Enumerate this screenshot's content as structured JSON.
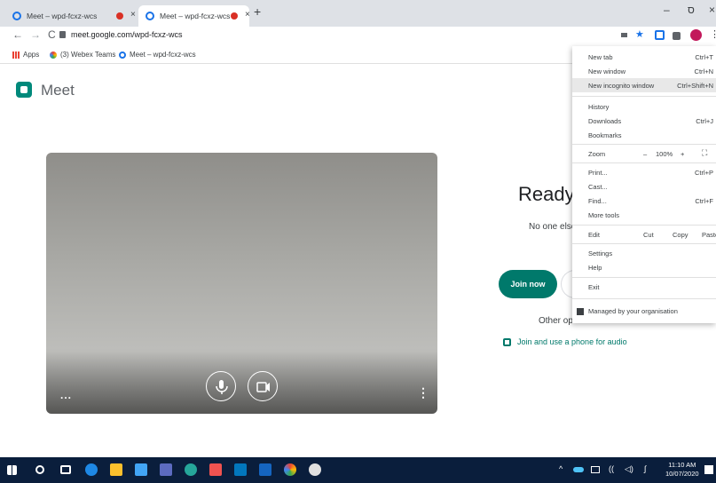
{
  "tabs": [
    {
      "title": "Meet – wpd-fcxz-wcs",
      "active": false
    },
    {
      "title": "Meet – wpd-fcxz-wcs",
      "active": true
    }
  ],
  "tab_close_glyph": "×",
  "new_tab_glyph": "+",
  "window_controls": {
    "minimize": "–",
    "maximize": "ס",
    "close": "×"
  },
  "nav": {
    "back": "←",
    "forward": "→",
    "reload": "C"
  },
  "address": "meet.google.com/wpd-fcxz-wcs",
  "bookmarks": [
    {
      "label": "Apps",
      "icon": "apps-grid-icon"
    },
    {
      "label": "(3) Webex Teams",
      "icon": "webex-icon"
    },
    {
      "label": "Meet – wpd-fcxz-wcs",
      "icon": "meet-icon"
    }
  ],
  "page": {
    "brand": "Meet",
    "ready_text": "Ready to",
    "no_one_text": "No one else",
    "join_label": "Join now",
    "other_text": "Other op",
    "phone_text": "Join and use a phone for audio",
    "video_dots": "...",
    "video_more": "⋮"
  },
  "menu": {
    "new_tab": {
      "label": "New tab",
      "shortcut": "Ctrl+T"
    },
    "new_window": {
      "label": "New window",
      "shortcut": "Ctrl+N"
    },
    "incognito": {
      "label": "New incognito window",
      "shortcut": "Ctrl+Shift+N"
    },
    "history": {
      "label": "History"
    },
    "downloads": {
      "label": "Downloads",
      "shortcut": "Ctrl+J"
    },
    "bookmarks": {
      "label": "Bookmarks"
    },
    "zoom": {
      "label": "Zoom",
      "minus": "–",
      "value": "100%",
      "plus": "+",
      "fullscreen": "⛶"
    },
    "print": {
      "label": "Print...",
      "shortcut": "Ctrl+P"
    },
    "cast": {
      "label": "Cast..."
    },
    "find": {
      "label": "Find...",
      "shortcut": "Ctrl+F"
    },
    "more_tools": {
      "label": "More tools"
    },
    "edit": {
      "label": "Edit",
      "cut": "Cut",
      "copy": "Copy",
      "paste": "Paste"
    },
    "settings": {
      "label": "Settings"
    },
    "help": {
      "label": "Help"
    },
    "exit": {
      "label": "Exit"
    },
    "managed": {
      "label": "Managed by your organisation"
    }
  },
  "taskbar": {
    "time": "11:10 AM",
    "date": "10/07/2020"
  },
  "colors": {
    "accent": "#00796b",
    "taskbar": "#0a1e3c",
    "tab_strip": "#dee1e6"
  }
}
